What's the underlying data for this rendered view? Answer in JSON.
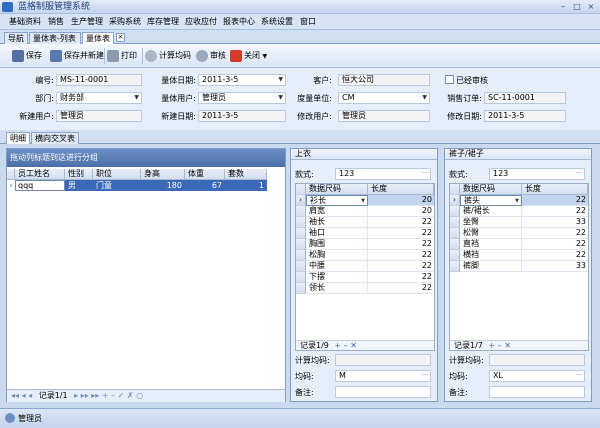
{
  "window": {
    "title": "蓝格制服管理系统",
    "minimize": "–",
    "maximize": "□",
    "close": "×"
  },
  "menu": [
    "基础资料",
    "销售",
    "生产管理",
    "采购系统",
    "库存管理",
    "应收应付",
    "报表中心",
    "系统设置",
    "窗口"
  ],
  "tabs": [
    {
      "label": "导航"
    },
    {
      "label": "量体表-列表"
    },
    {
      "label": "量体表"
    }
  ],
  "tab_close": "×",
  "toolbar": {
    "save": "保存",
    "save_new": "保存并新建",
    "print": "打印",
    "calc": "计算均码",
    "audit": "审核",
    "close": "关闭",
    "close_arrow": "▼"
  },
  "form": {
    "code_label": "编号:",
    "code": "MS-11-0001",
    "date_label": "量体日期:",
    "date": "2011-3-5",
    "customer_label": "客户:",
    "customer": "恒大公司",
    "audited_label": "已经审核",
    "dept_label": "部门:",
    "dept": "财务部",
    "user_label": "量体用户:",
    "user": "管理员",
    "unit_label": "度量单位:",
    "unit": "CM",
    "order_label": "销售订单:",
    "order": "SC-11-0001",
    "creator_label": "新建用户:",
    "creator": "管理员",
    "created_label": "新建日期:",
    "created": "2011-3-5",
    "modifier_label": "修改用户:",
    "modifier": "管理员",
    "modified_label": "修改日期:",
    "modified": "2011-3-5"
  },
  "subtabs": [
    {
      "label": "明细"
    },
    {
      "label": "横向交叉表"
    }
  ],
  "left_grid": {
    "group_hint": "拖动列标题到这进行分组",
    "columns": [
      "员工姓名",
      "性别",
      "职位",
      "身高",
      "体重",
      "套数"
    ],
    "rows": [
      {
        "name": "qqq",
        "gender": "男",
        "position": "门童",
        "height": "180",
        "weight": "67",
        "sets": "1"
      }
    ],
    "nav": "记录1/1",
    "nav_icons": "◂◂ ◂ ◂",
    "nav_icons2": "▸ ▸▸ ▸▸ + – ✓ ✗ ○"
  },
  "upper": {
    "title": "上衣",
    "style_label": "款式:",
    "style": "123",
    "col_size": "数据尺码",
    "col_len": "长度",
    "rows": [
      {
        "name": "衫长",
        "value": "20"
      },
      {
        "name": "肩宽",
        "value": "20"
      },
      {
        "name": "袖长",
        "value": "22"
      },
      {
        "name": "袖口",
        "value": "22"
      },
      {
        "name": "胸围",
        "value": "22"
      },
      {
        "name": "松胸",
        "value": "22"
      },
      {
        "name": "中腰",
        "value": "22"
      },
      {
        "name": "下摆",
        "value": "22"
      },
      {
        "name": "领长",
        "value": "22"
      }
    ],
    "nav": "记录1/9",
    "nav_icons": "+ – ✕",
    "avg_label": "计算均码:",
    "avg_code_label": "均码:",
    "avg_code": "M",
    "note_label": "备注:"
  },
  "lower": {
    "title": "裤子/裙子",
    "style_label": "款式:",
    "style": "123",
    "col_size": "数据尺码",
    "col_len": "长度",
    "rows": [
      {
        "name": "裤头",
        "value": "22"
      },
      {
        "name": "裤/裙长",
        "value": "22"
      },
      {
        "name": "坐臀",
        "value": "33"
      },
      {
        "name": "松臀",
        "value": "22"
      },
      {
        "name": "直裆",
        "value": "22"
      },
      {
        "name": "横裆",
        "value": "22"
      },
      {
        "name": "裤脚",
        "value": "33"
      }
    ],
    "nav": "记录1/7",
    "nav_icons": "+ – ✕",
    "avg_label": "计算均码:",
    "avg_code_label": "均码:",
    "avg_code": "XL",
    "note_label": "备注:"
  },
  "status": {
    "user": "管理员"
  },
  "glyphs": {
    "dropdown": "▼",
    "ellipsis": "···",
    "row_arrow": "›",
    "row_indicator": "›"
  },
  "colors": {
    "accent": "#3b69b7",
    "header": "#4a6fa8"
  }
}
